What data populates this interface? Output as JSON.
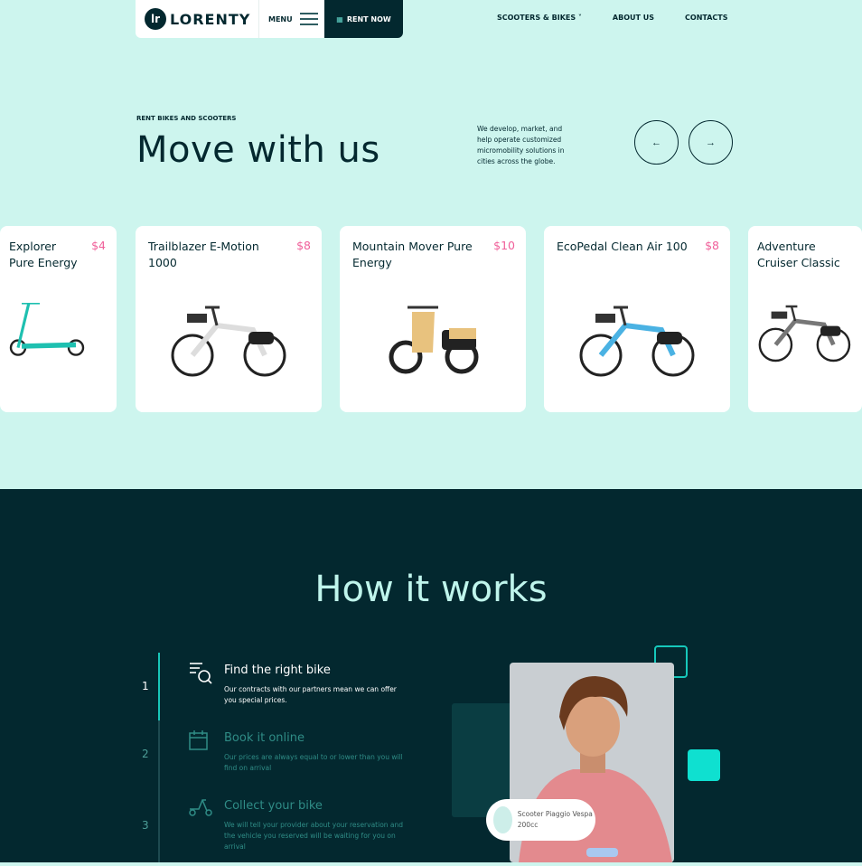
{
  "nav": {
    "logo_mark": "lr",
    "logo_text": "LORENTY",
    "menu": "MENU",
    "rent_now": "RENT NOW",
    "links": [
      "SCOOTERS & BIKES",
      "ABOUT US",
      "CONTACTS"
    ],
    "dropdown_icon": "chevron-down-icon"
  },
  "hero": {
    "eyebrow": "RENT BIKES AND SCOOTERS",
    "title": "Move with us",
    "description": "We develop, market, and help operate customized micromobility solutions in cities across the globe.",
    "prev": "←",
    "next": "→"
  },
  "cards": [
    {
      "name": "Explorer Pure Energy",
      "price": "$4",
      "type": "kick-scooter"
    },
    {
      "name": "Trailblazer E-Motion 1000",
      "price": "$8",
      "type": "e-bike"
    },
    {
      "name": "Mountain Mover Pure Energy",
      "price": "$10",
      "type": "moped"
    },
    {
      "name": "EcoPedal Clean Air 100",
      "price": "$8",
      "type": "e-bike"
    },
    {
      "name": "Adventure Cruiser Classic",
      "price": "",
      "type": "e-bike"
    }
  ],
  "how": {
    "title": "How it works",
    "steps": [
      {
        "num": "1",
        "title": "Find the right bike",
        "text": "Our contracts with our partners mean we can offer you special prices.",
        "icon": "search-list-icon"
      },
      {
        "num": "2",
        "title": "Book it online",
        "text": "Our prices are always equal to or lower than you will find on arrival",
        "icon": "calendar-icon"
      },
      {
        "num": "3",
        "title": "Collect your bike",
        "text": "We will tell your provider about your reservation and the vehicle you reserved will be waiting for you on arrival",
        "icon": "scooter-icon"
      }
    ],
    "badge": "Scooter Piaggio Vespa 200cc"
  },
  "colors": {
    "mint": "#cdf5ee",
    "dark": "#03282f",
    "accent": "#0fe0d0",
    "price": "#f0609a"
  }
}
